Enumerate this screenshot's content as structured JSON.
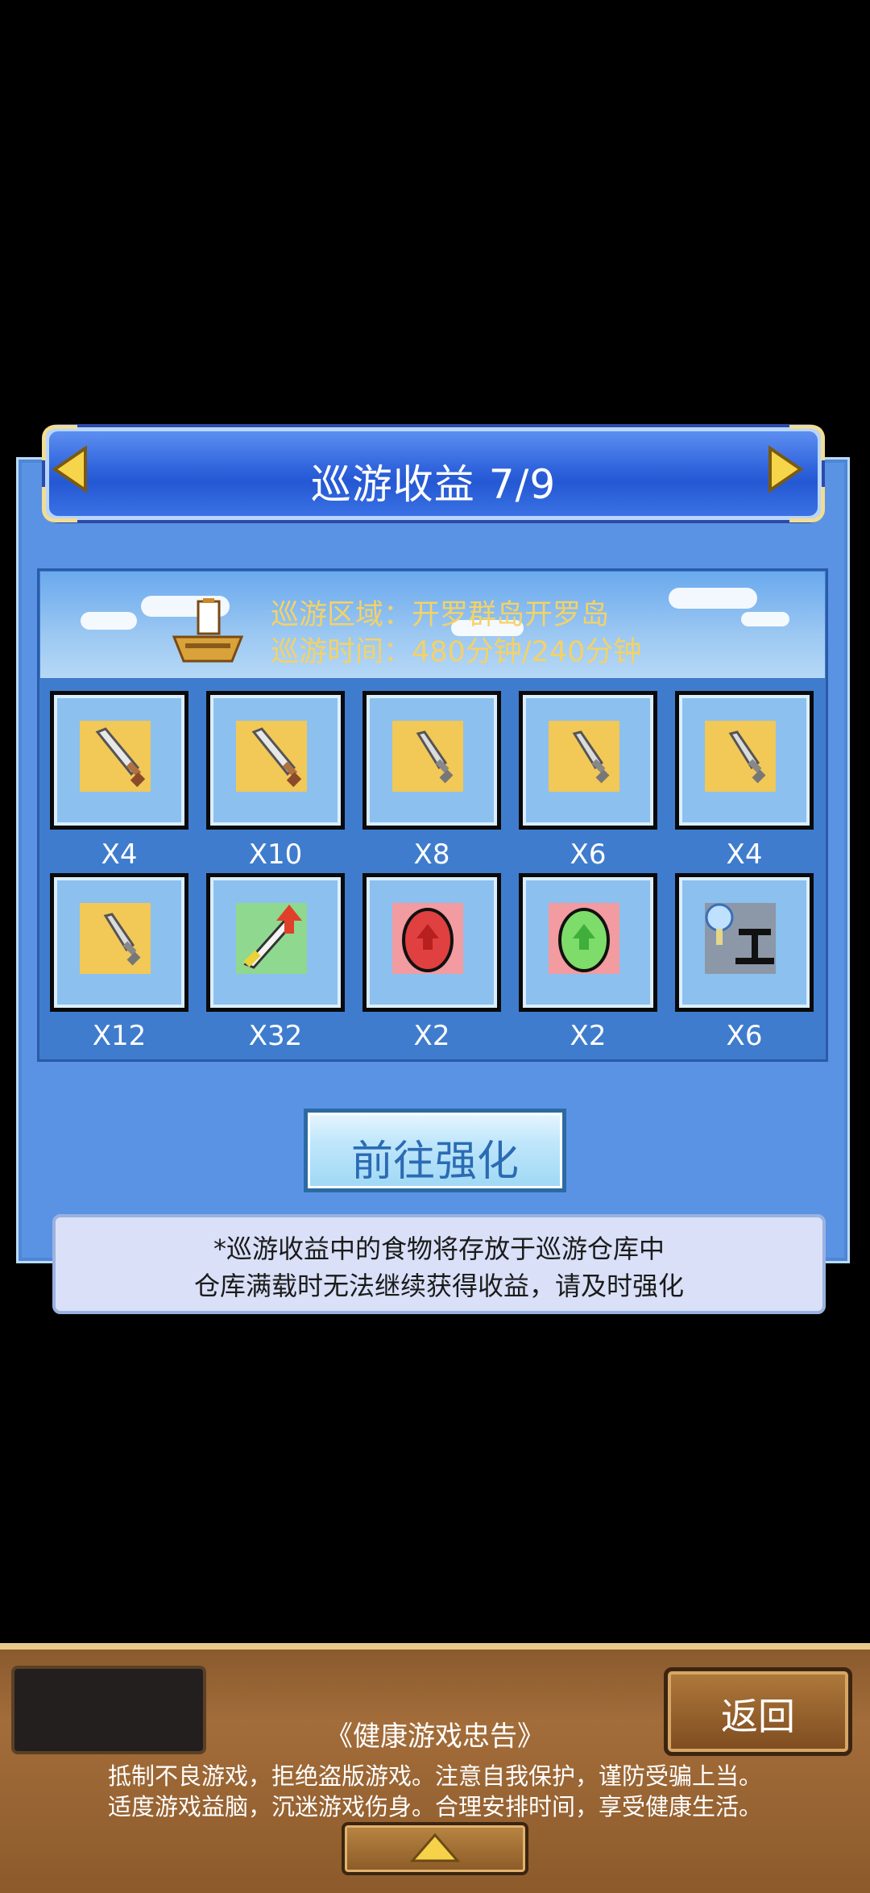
{
  "dialog": {
    "title": "巡游收益 7/9",
    "region_line": "巡游区域：开罗群岛开罗岛",
    "time_line": "巡游时间：480分钟/240分钟"
  },
  "items": [
    {
      "icon": "sword-icon",
      "qty": "X4"
    },
    {
      "icon": "sword-icon",
      "qty": "X10"
    },
    {
      "icon": "dagger-icon",
      "qty": "X8"
    },
    {
      "icon": "dagger-icon",
      "qty": "X6"
    },
    {
      "icon": "dagger-icon",
      "qty": "X4"
    },
    {
      "icon": "dagger-icon",
      "qty": "X12"
    },
    {
      "icon": "sword-upgrade-icon",
      "qty": "X32"
    },
    {
      "icon": "red-egg-icon",
      "qty": "X2"
    },
    {
      "icon": "green-egg-icon",
      "qty": "X2"
    },
    {
      "icon": "tool-icon",
      "qty": "X6"
    }
  ],
  "actions": {
    "go_enhance": "前往强化"
  },
  "notice": {
    "line1": "*巡游收益中的食物将存放于巡游仓库中",
    "line2": "仓库满载时无法继续获得收益，请及时强化"
  },
  "bottom": {
    "back_label": "返回",
    "health_title": "《健康游戏忠告》",
    "health_line1": "抵制不良游戏，拒绝盗版游戏。注意自我保护，谨防受骗上当。",
    "health_line2": "适度游戏益脑，沉迷游戏伤身。合理安排时间，享受健康生活。"
  },
  "colors": {
    "dialog_bg": "#5a93e4",
    "title_bar": "#2f63dc",
    "info_text": "#f3d267",
    "button_text": "#2b6bb3",
    "bottom_panel": "#a36d3a"
  }
}
